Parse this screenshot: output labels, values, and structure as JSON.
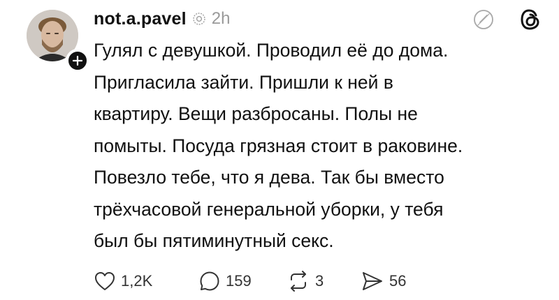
{
  "post": {
    "username": "not.a.pavel",
    "timestamp": "2h",
    "paragraphs": [
      [
        "Гулял с девушкой. Проводил её до дома.",
        "Пригласила зайти. Пришли к ней в",
        "квартиру. Вещи разбросаны. Полы не",
        "помыты. Посуда грязная стоит в раковине."
      ],
      [
        "Повезло тебе, что я дева. Так бы вместо",
        "трёхчасовой генеральной уборки, у тебя",
        "был бы пятиминутный секс."
      ]
    ],
    "actions": {
      "likes": "1,2K",
      "replies": "159",
      "reposts": "3",
      "shares": "56"
    }
  },
  "icons": {
    "follow": "plus-icon",
    "edited": "reposted-icon",
    "more": "quote-off-icon",
    "app": "threads-logo"
  },
  "colors": {
    "text": "#111111",
    "muted": "#9a9a9a",
    "badge": "#111111"
  }
}
